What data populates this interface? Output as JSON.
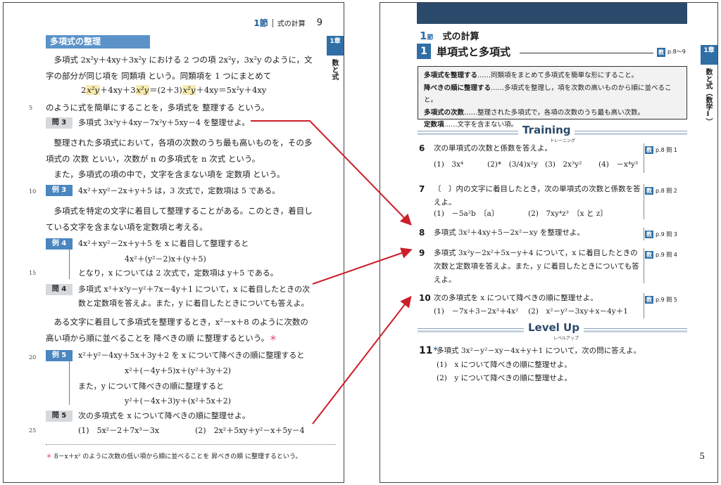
{
  "left_page": {
    "running_head": {
      "section": "1節",
      "title": "式の計算",
      "page_number": "9"
    },
    "chapter_tab": {
      "label": "1章",
      "vertical": "数と式"
    },
    "heading": "多項式の整理",
    "para1": "多項式 2x²y＋4xy＋3x²y における 2 つの項 2x²y，3x²y のように，文字の部分が同じ項を 同類項 という。同類項を 1 つにまとめて",
    "eq1": {
      "a": "2",
      "b": "x²y",
      "c": "＋4xy＋3",
      "d": "x²y",
      "e": "＝(2＋3)",
      "f": "x²y",
      "g": "＋4xy＝5x²y＋4xy"
    },
    "para1_end": "のように式を簡単にすることを，多項式を 整理する という。",
    "q3": {
      "label": "問 3",
      "text": "多項式 3x²y＋4xy－7x²y＋5xy－4 を整理せよ。"
    },
    "para2": "整理された多項式において，各項の次数のうち最も高いものを，その多項式の 次数 といい，次数が n の多項式を n 次式 という。",
    "para3": "また，多項式の項の中で，文字を含まない項を 定数項 という。",
    "ex3": {
      "label": "例 3",
      "text": "4x²＋xy²－2x＋y＋5 は，3 次式で，定数項は 5 である。"
    },
    "para4": "多項式を特定の文字に着目して整理することがある。このとき，着目している文字を含まない項を定数項と考える。",
    "ex4": {
      "label": "例 4",
      "line1": "4x²＋xy²－2x＋y＋5 を x に着目して整理すると",
      "line2": "4x²＋(y²－2)x＋(y＋5)",
      "line3": "となり，x については 2 次式で，定数項は y＋5 である。"
    },
    "q4": {
      "label": "問 4",
      "line1": "多項式 x³＋x²y－y²＋7x－4y＋1 について，x に着目したときの次",
      "line2": "数と定数項を答えよ。また，y に着目したときについても答えよ。"
    },
    "para5": "ある文字に着目して多項式を整理するとき，x²－x＋8 のように次数の高い項から順に並べることを 降べきの順 に整理するという。",
    "para5_star": "＊",
    "ex5": {
      "label": "例 5",
      "line1": "x²＋y²－4xy＋5x＋3y＋2 を x について降べきの順に整理すると",
      "line2": "x²＋(－4y＋5)x＋(y²＋3y＋2)",
      "line3": "また，y について降べきの順に整理すると",
      "line4": "y²＋(－4x＋3)y＋(x²＋5x＋2)"
    },
    "q5": {
      "label": "問 5",
      "text": "次の多項式を x について降べきの順に整理せよ。",
      "p1": "(1)　5x²－2＋7x³－3x",
      "p2": "(2)　2x²＋5xy＋y²－x＋5y－4"
    },
    "line_numbers": [
      "5",
      "10",
      "15",
      "20",
      "25"
    ],
    "footnote_mark": "＊",
    "footnote": "8－x＋x² のように次数の低い項から順に並べることを 昇べきの順 に整理するという。"
  },
  "right_page": {
    "section": {
      "num": "1",
      "suffix": "節",
      "title": "式の計算"
    },
    "title_num": "1",
    "title": "単項式と多項式",
    "ref_badge": "教",
    "ref_text": "p.8〜9",
    "chapter_tab": {
      "label": "1章",
      "vertical": "数と式（数学Ⅰ）"
    },
    "definitions": [
      {
        "term": "多項式を整理する",
        "desc": "……同類項をまとめて多項式を簡単な形にすること。"
      },
      {
        "term": "降べきの順に整理する",
        "desc": "……多項式を整理し，項を次数の高いものから順に並べること。"
      },
      {
        "term": "多項式の次数",
        "desc": "……整理された多項式で，各項の次数のうち最も高い次数。"
      },
      {
        "term": "定数項",
        "desc": "……文字を含まない項。"
      }
    ],
    "training": {
      "label": "Training",
      "ruby": "トレーニング"
    },
    "levelup": {
      "label": "Level Up",
      "ruby": "レベルアップ"
    },
    "problems": [
      {
        "num": "6",
        "text": "次の単項式の次数と係数を答えよ。",
        "parts": [
          "(1)　3x⁴",
          "(2)*　(3/4)x²y",
          "(3)　2x³y²",
          "(4)　－x⁴y³"
        ],
        "ref": "p.8 問 1"
      },
      {
        "num": "7",
        "text": "〔　〕内の文字に着目したとき，次の単項式の次数と係数を答えよ。",
        "parts": [
          "(1)　－5a²b　〔a〕",
          "(2)　7xy⁴z³　〔x と z〕"
        ],
        "ref": "p.8 問 2"
      },
      {
        "num": "8",
        "text": "多項式 3x²＋4xy＋5－2x²－xy を整理せよ。",
        "ref": "p.9 問 3"
      },
      {
        "num": "9",
        "text": "多項式 3x²y－2x²＋5x－y＋4 について，x に着目したときの次数と定数項を答えよ。また，y に着目したときについても答えよ。",
        "ref": "p.9 問 4"
      },
      {
        "num": "10",
        "text": "次の多項式を x について降べきの順に整理せよ。",
        "parts": [
          "(1)　－7x＋3－2x³＋4x²",
          "(2)　x²－y²－3xy＋x－4y＋1"
        ],
        "ref": "p.9 問 5"
      }
    ],
    "levelup_problem": {
      "num": "11",
      "mark": "＊",
      "text": "多項式 3x²－y²－xy－4x＋y＋1 について，次の問に答えよ。",
      "parts": [
        "(1)　x について降べきの順に整理せよ。",
        "(2)　y について降べきの順に整理せよ。"
      ]
    },
    "page_number": "5"
  },
  "colors": {
    "accent": "#2f6fa6",
    "banner": "#2b4a6b",
    "arrow": "#cc1e2b",
    "highlight": "#f7eab0"
  }
}
